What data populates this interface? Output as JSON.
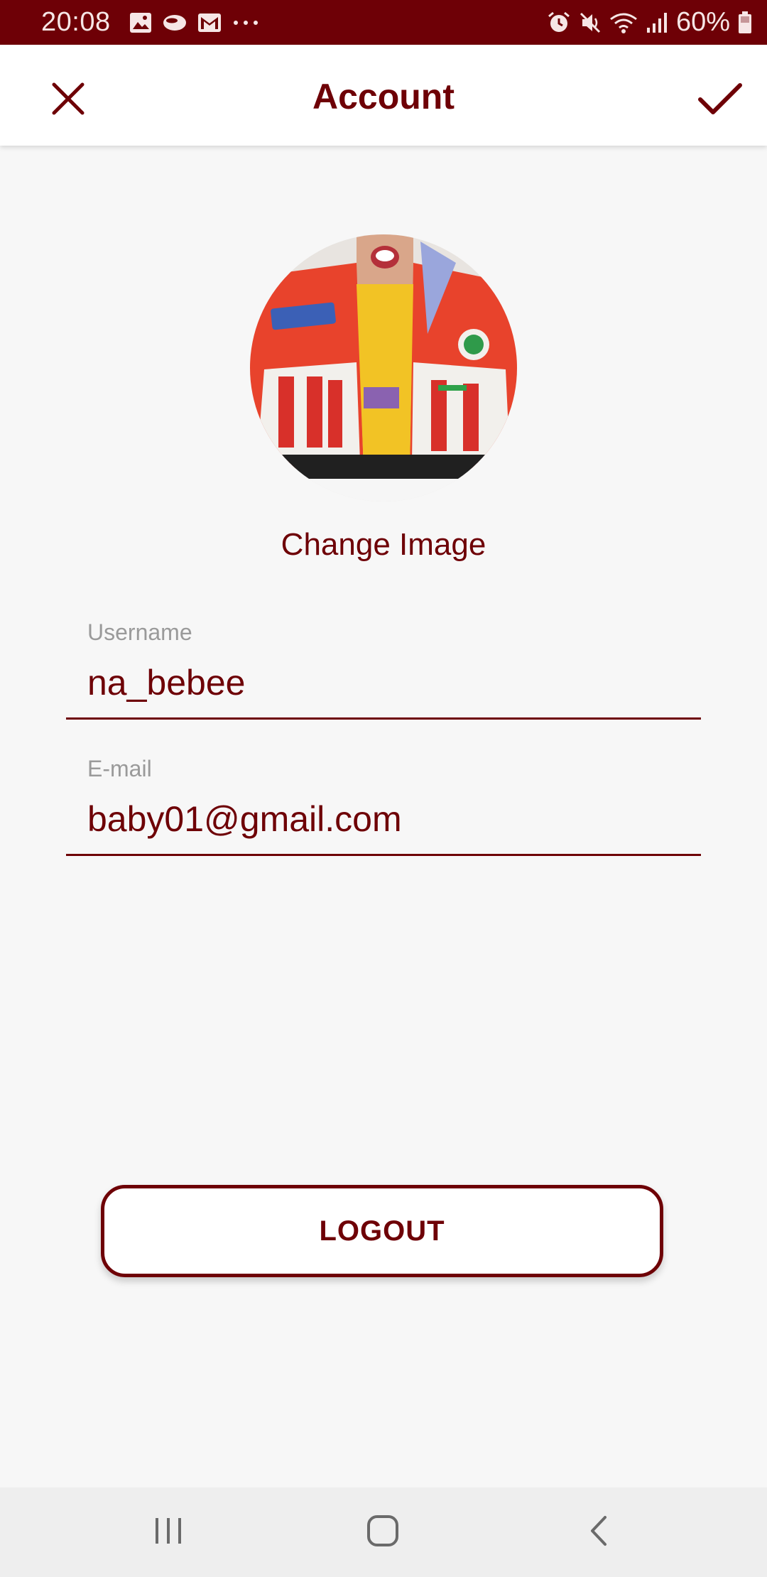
{
  "status_bar": {
    "time": "20:08",
    "battery": "60%",
    "icons_left": [
      "gallery-icon",
      "cloud-icon",
      "gmail-icon",
      "more-dots-icon"
    ],
    "icons_right": [
      "alarm-icon",
      "mute-icon",
      "wifi-icon",
      "signal-icon",
      "battery-icon"
    ]
  },
  "app_bar": {
    "title": "Account",
    "close_icon": "close-icon",
    "confirm_icon": "check-icon"
  },
  "profile": {
    "avatar": "avatar-photo",
    "change_image_label": "Change Image"
  },
  "fields": {
    "username": {
      "label": "Username",
      "value": "na_bebee"
    },
    "email": {
      "label": "E-mail",
      "value": "baby01@gmail.com"
    }
  },
  "logout_label": "LOGOUT",
  "nav_bar": {
    "recents_icon": "recents-icon",
    "home_icon": "home-icon",
    "back_icon": "back-icon"
  },
  "colors": {
    "accent": "#6e0006",
    "background": "#f7f7f7",
    "app_bar": "#ffffff",
    "label_gray": "#9a9a9a",
    "nav_bar": "#eeeeee"
  }
}
